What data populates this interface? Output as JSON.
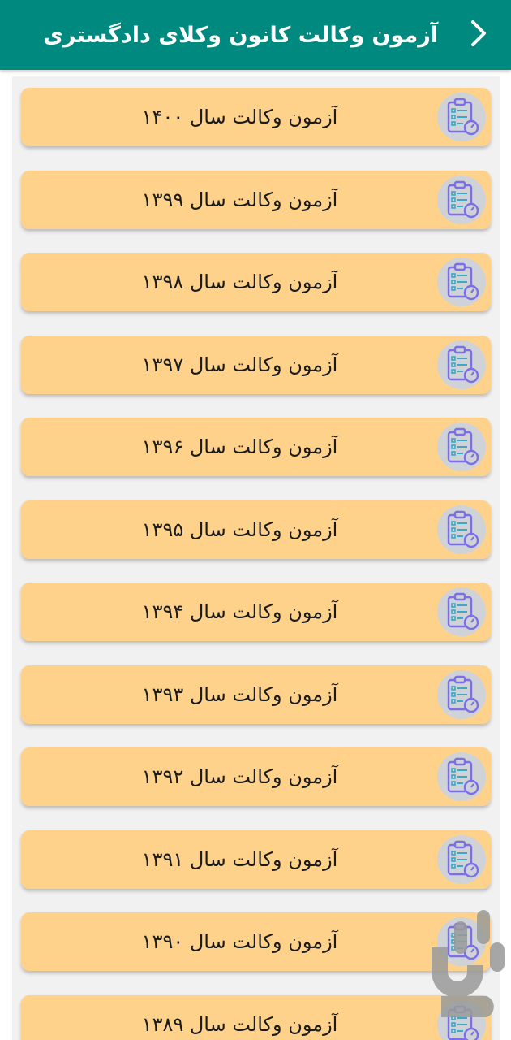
{
  "header": {
    "title": "آزمون وکالت کانون وکلای دادگستری",
    "back_icon": "chevron-right-icon"
  },
  "colors": {
    "appbar": "#00897f",
    "card": "#ffd28c",
    "list_background": "#f1f1f1",
    "icon_circle": "#cfd2d6",
    "icon_stroke": "#7b6ee8"
  },
  "exams": [
    {
      "label": "آزمون وکالت سال ۱۴۰۰",
      "icon": "exam-clipboard-icon"
    },
    {
      "label": "آزمون وکالت سال ۱۳۹۹",
      "icon": "exam-clipboard-icon"
    },
    {
      "label": "آزمون وکالت سال ۱۳۹۸",
      "icon": "exam-clipboard-icon"
    },
    {
      "label": "آزمون وکالت سال ۱۳۹۷",
      "icon": "exam-clipboard-icon"
    },
    {
      "label": "آزمون وکالت سال ۱۳۹۶",
      "icon": "exam-clipboard-icon"
    },
    {
      "label": "آزمون وکالت سال ۱۳۹۵",
      "icon": "exam-clipboard-icon"
    },
    {
      "label": "آزمون وکالت سال ۱۳۹۴",
      "icon": "exam-clipboard-icon"
    },
    {
      "label": "آزمون وکالت سال ۱۳۹۳",
      "icon": "exam-clipboard-icon"
    },
    {
      "label": "آزمون وکالت سال ۱۳۹۲",
      "icon": "exam-clipboard-icon"
    },
    {
      "label": "آزمون وکالت سال ۱۳۹۱",
      "icon": "exam-clipboard-icon"
    },
    {
      "label": "آزمون وکالت سال ۱۳۹۰",
      "icon": "exam-clipboard-icon"
    },
    {
      "label": "آزمون وکالت سال ۱۳۸۹",
      "icon": "exam-clipboard-icon"
    }
  ]
}
